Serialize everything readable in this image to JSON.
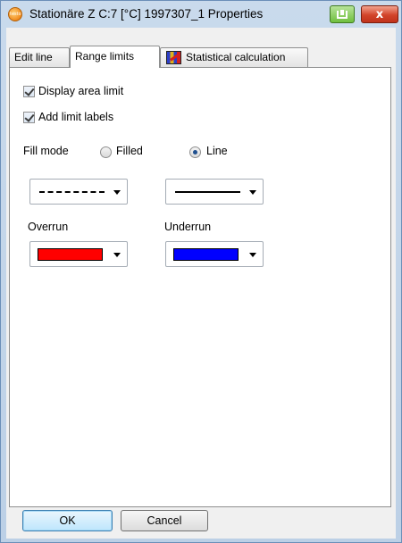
{
  "window": {
    "title": "Stationäre Z C:7 [°C] 1997307_1 Properties",
    "app_icon_text": "testo",
    "close_label": "x"
  },
  "tabs": [
    {
      "label": "Edit line",
      "active": false
    },
    {
      "label": "Range limits",
      "active": true
    },
    {
      "label": "Statistical calculation",
      "active": false
    }
  ],
  "range_limits": {
    "display_area_limit": {
      "label": "Display area limit",
      "checked": true
    },
    "add_limit_labels": {
      "label": "Add limit labels",
      "checked": true
    },
    "fill_mode": {
      "label": "Fill mode",
      "options": [
        {
          "label": "Filled",
          "selected": false
        },
        {
          "label": "Line",
          "selected": true
        }
      ]
    },
    "line_style_left": "dash-dot",
    "line_style_right": "solid",
    "overrun": {
      "label": "Overrun",
      "color": "#ff0000"
    },
    "underrun": {
      "label": "Underrun",
      "color": "#0000ff"
    }
  },
  "buttons": {
    "ok": "OK",
    "cancel": "Cancel"
  }
}
